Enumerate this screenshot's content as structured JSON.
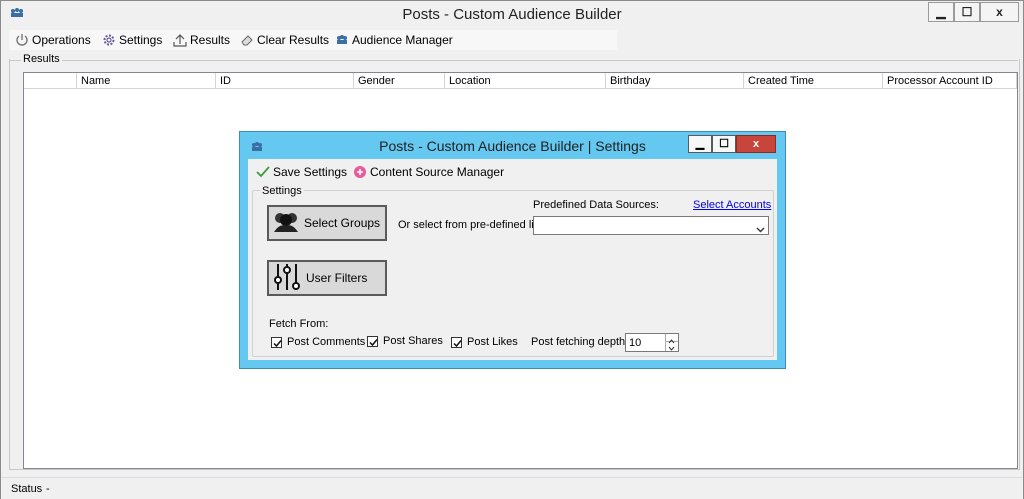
{
  "window": {
    "title": "Posts - Custom Audience Builder",
    "minimize": "▁",
    "maximize": "☐",
    "close": "x"
  },
  "toolbar": {
    "operations": "Operations",
    "settings": "Settings",
    "results": "Results",
    "clear_results": "Clear Results",
    "audience_manager": "Audience Manager"
  },
  "results_group": {
    "label": "Results"
  },
  "grid": {
    "columns": [
      "Name",
      "ID",
      "Gender",
      "Location",
      "Birthday",
      "Created Time",
      "Processor Account ID"
    ]
  },
  "status": {
    "label": "Status",
    "value": "-"
  },
  "dialog": {
    "title": "Posts - Custom Audience Builder | Settings",
    "toolbar": {
      "save": "Save Settings",
      "content_source": "Content Source Manager"
    },
    "settings_label": "Settings",
    "select_groups": "Select Groups",
    "user_filters": "User Filters",
    "or_select": "Or select from pre-defined list",
    "predefined_label": "Predefined Data Sources:",
    "select_accounts": "Select Accounts",
    "predefined_value": "",
    "fetch_from": "Fetch From:",
    "post_comments": "Post Comments",
    "post_shares": "Post Shares",
    "post_likes": "Post Likes",
    "depth_label": "Post fetching depth",
    "depth_value": "10",
    "colors": {
      "accent": "#64c8f0",
      "close": "#c7453b",
      "link": "#0000ee"
    }
  }
}
